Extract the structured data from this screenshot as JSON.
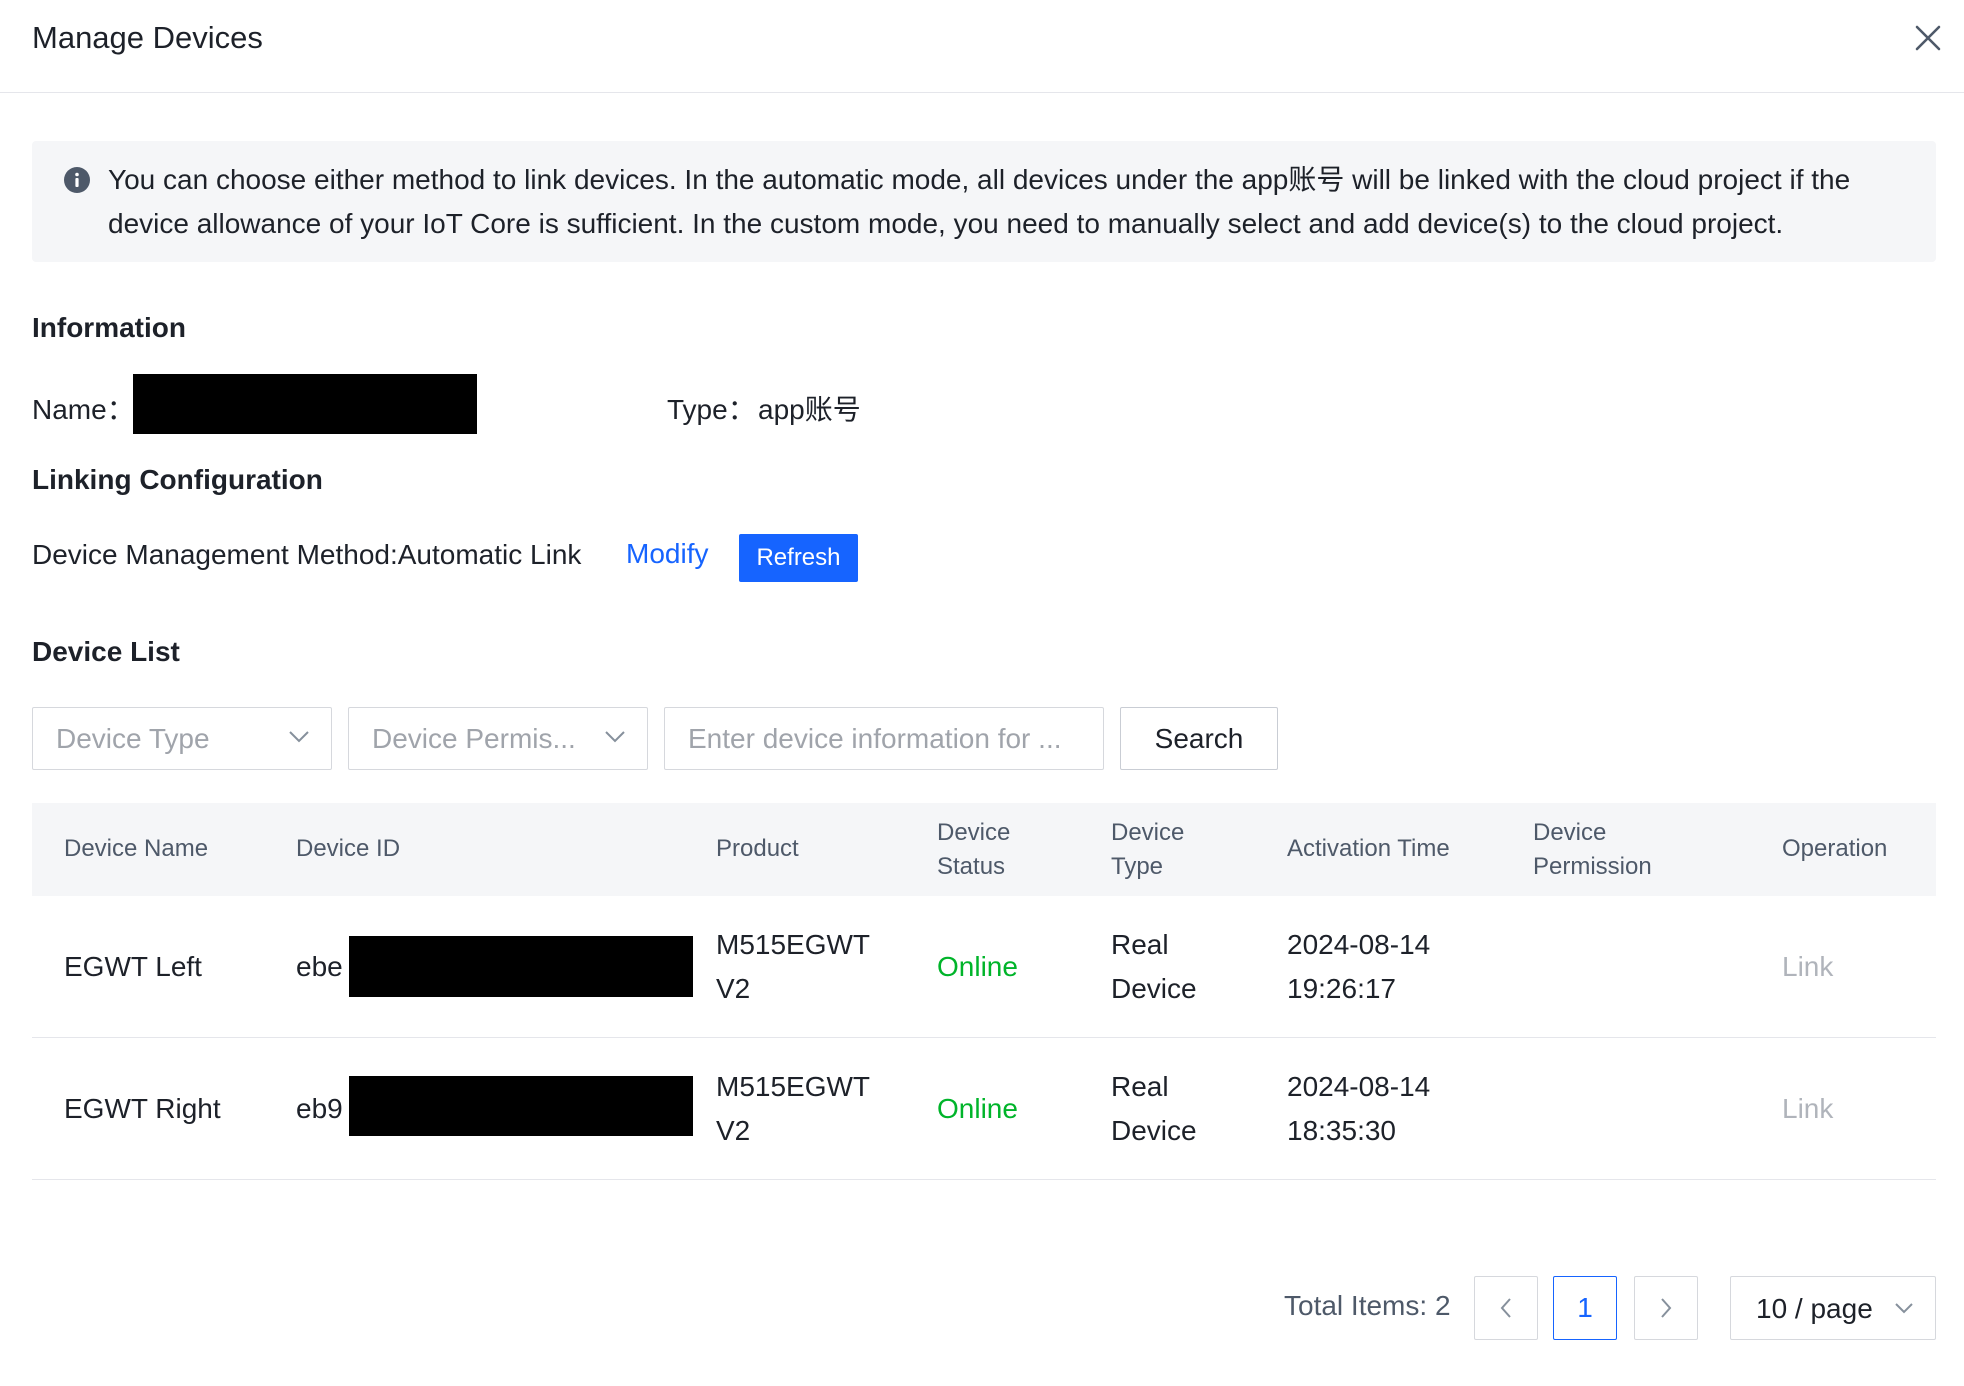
{
  "dialog": {
    "title": "Manage Devices"
  },
  "notice": {
    "text": "You can choose either method to link devices. In the automatic mode, all devices under the app账号 will be linked with the cloud project if the device allowance of your IoT Core is sufficient. In the custom mode, you need to manually select and add device(s) to the cloud project."
  },
  "information": {
    "heading": "Information",
    "name_label": "Name：",
    "type_label": "Type：",
    "type_value": "app账号"
  },
  "linking": {
    "heading": "Linking Configuration",
    "method_text": "Device Management Method:Automatic Link",
    "modify_label": "Modify",
    "refresh_label": "Refresh"
  },
  "device_list": {
    "heading": "Device List",
    "device_type_placeholder": "Device Type",
    "device_permission_placeholder": "Device Permis...",
    "search_placeholder": "Enter device information for ...",
    "search_label": "Search",
    "columns": {
      "name": "Device Name",
      "id": "Device ID",
      "product": "Product",
      "status": [
        "Device",
        "Status"
      ],
      "type": [
        "Device",
        "Type"
      ],
      "activation": "Activation Time",
      "permission": [
        "Device",
        "Permission"
      ],
      "operation": "Operation"
    },
    "rows": [
      {
        "name": "EGWT Left",
        "id_prefix": "ebe",
        "product": [
          "M515EGWT",
          "V2"
        ],
        "status": "Online",
        "type": [
          "Real",
          "Device"
        ],
        "activation": [
          "2024-08-14",
          "19:26:17"
        ],
        "permission": "",
        "operation": "Link"
      },
      {
        "name": "EGWT Right",
        "id_prefix": "eb9",
        "product": [
          "M515EGWT",
          "V2"
        ],
        "status": "Online",
        "type": [
          "Real",
          "Device"
        ],
        "activation": [
          "2024-08-14",
          "18:35:30"
        ],
        "permission": "",
        "operation": "Link"
      }
    ]
  },
  "pagination": {
    "total_text": "Total Items: 2",
    "current_page": "1",
    "page_size": "10 / page"
  },
  "colors": {
    "primary": "#1664ff",
    "online": "#00b42a",
    "header_bg": "#f5f6f8"
  }
}
